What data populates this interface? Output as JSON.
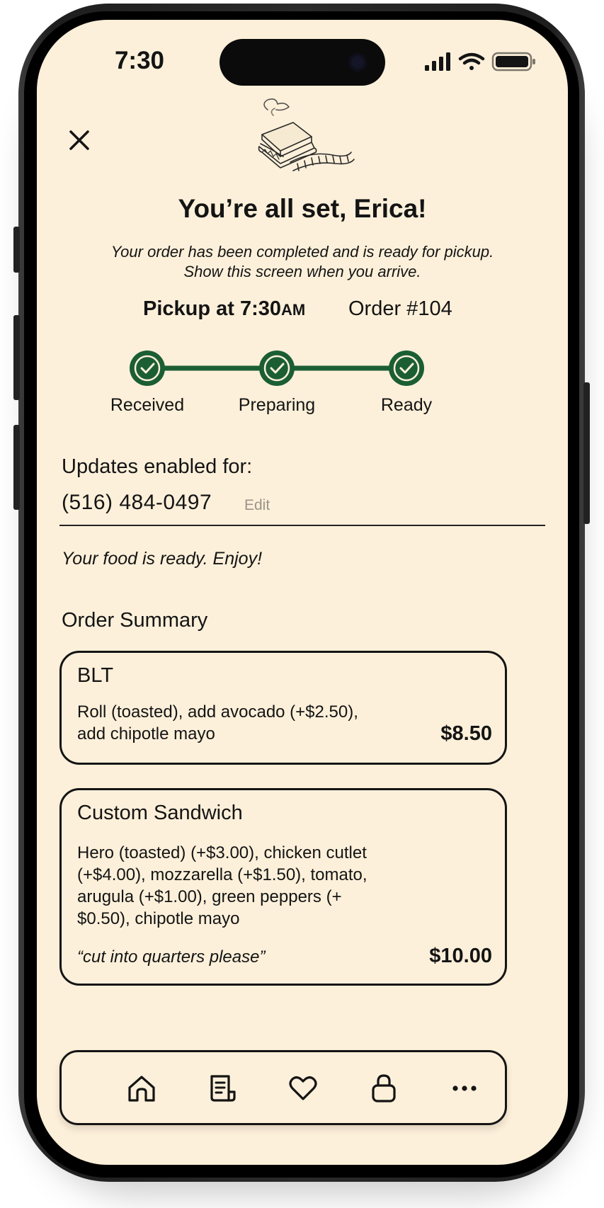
{
  "status_bar": {
    "time": "7:30"
  },
  "header": {
    "title": "You’re all set, Erica!",
    "subtitle_line1": "Your order has been completed and is ready for pickup.",
    "subtitle_line2": "Show this screen when you arrive."
  },
  "pickup": {
    "label": "Pickup at 7:30",
    "ampm": "AM",
    "order_number": "Order #104"
  },
  "progress": {
    "accent_color": "#1b5e34",
    "steps": [
      {
        "label": "Received",
        "complete": true
      },
      {
        "label": "Preparing",
        "complete": true
      },
      {
        "label": "Ready",
        "complete": true
      }
    ]
  },
  "updates": {
    "label": "Updates enabled for:",
    "phone": "(516) 484-0497",
    "edit_label": "Edit"
  },
  "status_message": "Your food is ready. Enjoy!",
  "order_summary": {
    "heading": "Order Summary",
    "items": [
      {
        "name": "BLT",
        "desc_lines": [
          "Roll (toasted), add avocado (+$2.50),",
          "add chipotle mayo"
        ],
        "note": "",
        "price": "$8.50"
      },
      {
        "name": "Custom Sandwich",
        "desc_lines": [
          "Hero (toasted) (+$3.00), chicken cutlet",
          "(+$4.00), mozzarella (+$1.50), tomato,",
          "arugula (+$1.00), green peppers (+",
          "$0.50), chipotle mayo"
        ],
        "note": "“cut into quarters please”",
        "price": "$10.00"
      }
    ]
  },
  "nav": {
    "items": [
      {
        "icon": "home-icon"
      },
      {
        "icon": "receipt-icon"
      },
      {
        "icon": "heart-icon"
      },
      {
        "icon": "bag-icon"
      },
      {
        "icon": "more-icon"
      }
    ]
  },
  "colors": {
    "background": "#fdf0da",
    "text": "#141414",
    "accent": "#1b5e34"
  }
}
